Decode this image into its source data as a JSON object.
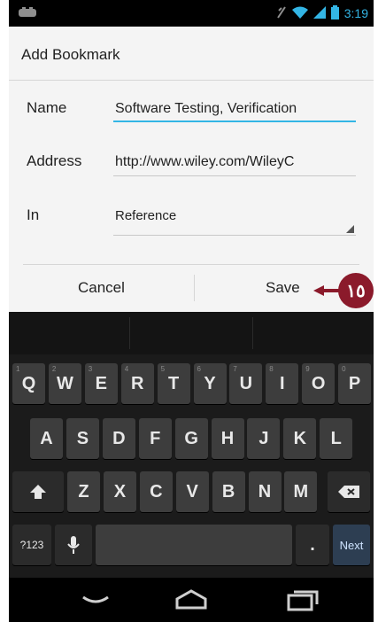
{
  "status": {
    "time": "3:19"
  },
  "dialog": {
    "title": "Add Bookmark",
    "name_label": "Name",
    "name_value": "Software Testing, Verification",
    "address_label": "Address",
    "address_value": "http://www.wiley.com/WileyC",
    "in_label": "In",
    "in_value": "Reference",
    "cancel": "Cancel",
    "save": "Save"
  },
  "callout": {
    "number": "١٥"
  },
  "keyboard": {
    "row1": [
      "Q",
      "W",
      "E",
      "R",
      "T",
      "Y",
      "U",
      "I",
      "O",
      "P"
    ],
    "row1_hints": [
      "1",
      "2",
      "3",
      "4",
      "5",
      "6",
      "7",
      "8",
      "9",
      "0"
    ],
    "row2": [
      "A",
      "S",
      "D",
      "F",
      "G",
      "H",
      "J",
      "K",
      "L"
    ],
    "row3": [
      "Z",
      "X",
      "C",
      "V",
      "B",
      "N",
      "M"
    ],
    "symbols_key": "?123",
    "period_key": ".",
    "next_key": "Next"
  },
  "icons": {
    "shift": "shift-icon",
    "backspace": "backspace-icon",
    "mic": "mic-icon",
    "back": "back-icon",
    "home": "home-icon",
    "recents": "recents-icon"
  },
  "colors": {
    "accent": "#33b5e5",
    "callout": "#8b1a2b",
    "next_key": "#2d3e52"
  }
}
